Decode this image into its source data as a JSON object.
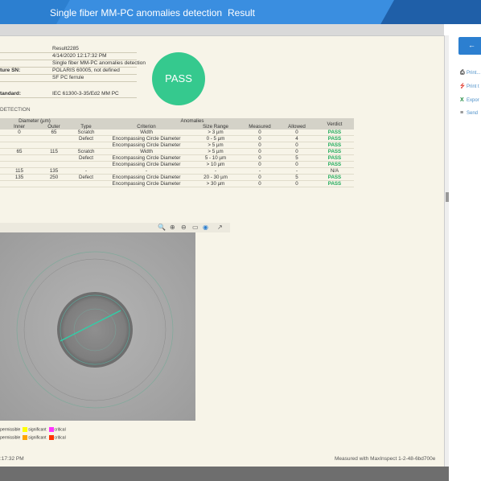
{
  "header": {
    "breadcrumb_test": "Single fiber MM-PC anomalies detection",
    "breadcrumb_result": "Result"
  },
  "info": {
    "rows": [
      {
        "key": "",
        "value": "Result2285"
      },
      {
        "key": "",
        "value": "4/14/2020 12:17:32 PM"
      },
      {
        "key": "",
        "value": "Single fiber MM-PC anomalies detection"
      },
      {
        "key": "ture SN:",
        "value": "POLARIS 60005, not defined"
      },
      {
        "key": "",
        "value": "SF PC ferrule"
      },
      {
        "key": "tandard:",
        "value": "IEC 61300-3-35/Ed2 MM PC"
      }
    ]
  },
  "verdict": "PASS",
  "section_title": "DETECTION",
  "table": {
    "group_headers": {
      "diameter": "Diameter (µm)",
      "anomalies": "Anomalies",
      "verdict": "Verdict"
    },
    "headers": [
      "Inner",
      "Outer",
      "Type",
      "Criterion",
      "Size Range",
      "Measured",
      "Allowed"
    ],
    "rows": [
      {
        "inner": "0",
        "outer": "65",
        "type": "Scratch",
        "criterion": "Width",
        "range": "> 3 µm",
        "measured": "0",
        "allowed": "0",
        "verdict": "PASS"
      },
      {
        "inner": "",
        "outer": "",
        "type": "Defect",
        "criterion": "Encompassing Circle Diameter",
        "range": "0 - 5 µm",
        "measured": "0",
        "allowed": "4",
        "verdict": "PASS"
      },
      {
        "inner": "",
        "outer": "",
        "type": "",
        "criterion": "Encompassing Circle Diameter",
        "range": "> 5 µm",
        "measured": "0",
        "allowed": "0",
        "verdict": "PASS"
      },
      {
        "inner": "65",
        "outer": "115",
        "type": "Scratch",
        "criterion": "Width",
        "range": "> 5 µm",
        "measured": "0",
        "allowed": "0",
        "verdict": "PASS"
      },
      {
        "inner": "",
        "outer": "",
        "type": "Defect",
        "criterion": "Encompassing Circle Diameter",
        "range": "5 - 10 µm",
        "measured": "0",
        "allowed": "5",
        "verdict": "PASS"
      },
      {
        "inner": "",
        "outer": "",
        "type": "",
        "criterion": "Encompassing Circle Diameter",
        "range": "> 10 µm",
        "measured": "0",
        "allowed": "0",
        "verdict": "PASS"
      },
      {
        "inner": "115",
        "outer": "135",
        "type": "-",
        "criterion": "-",
        "range": "-",
        "measured": "-",
        "allowed": "-",
        "verdict": "N/A"
      },
      {
        "inner": "135",
        "outer": "250",
        "type": "Defect",
        "criterion": "Encompassing Circle Diameter",
        "range": "20 - 30 µm",
        "measured": "0",
        "allowed": "5",
        "verdict": "PASS"
      },
      {
        "inner": "",
        "outer": "",
        "type": "",
        "criterion": "Encompassing Circle Diameter",
        "range": "> 30 µm",
        "measured": "0",
        "allowed": "0",
        "verdict": "PASS"
      }
    ]
  },
  "legend": {
    "row1": {
      "a": "permissible",
      "b": "significant",
      "c": "critical"
    },
    "row2": {
      "a": "permissible",
      "b": "significant",
      "c": "critical"
    },
    "colors": {
      "yellow": "#ffff00",
      "magenta": "#ff33ff",
      "orange": "#ffa500",
      "red": "#ff3300"
    }
  },
  "footer": {
    "time": ":17:32 PM",
    "measured_with": "Measured with MaxInspect 1-2-48-6bd700e"
  },
  "actions": [
    {
      "icon": "printer-icon",
      "label": "Print..."
    },
    {
      "icon": "pdf-icon",
      "label": "Print t"
    },
    {
      "icon": "excel-icon",
      "label": "Expor"
    },
    {
      "icon": "send-icon",
      "label": "Send"
    }
  ],
  "colors": {
    "accent": "#2c7fd0",
    "pass": "#35c98e",
    "report_bg": "#f7f4e8"
  }
}
